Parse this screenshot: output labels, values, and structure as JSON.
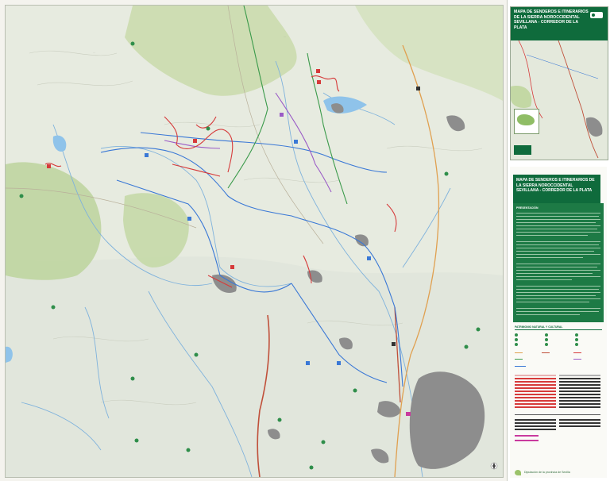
{
  "document": {
    "title": "MAPA DE SENDEROS E ITINERARIOS DE LA SIERRA NOROCCIDENTAL SEVILLANA - CORREDOR DE LA PLATA"
  },
  "info_panel": {
    "section_presentacion": "PRESENTACIÓN",
    "section_legend": "PATRIMONIO NATURAL Y CULTURAL"
  },
  "footer": {
    "publisher": "Diputación de la provincia de Sevilla"
  },
  "colors": {
    "background_relief": "#e6eadf",
    "natural_park": "#b8d19a",
    "urban_area": "#8d8d8d",
    "river": "#7fb2dc",
    "water_body": "#8fc3ea",
    "route_red": "#d63a3a",
    "route_blue": "#3a78d6",
    "route_green": "#3a9a4a",
    "route_purple": "#9a5bc6",
    "road_orange": "#e0a050",
    "road_rail": "#c0503a",
    "brand_green": "#0f6b3c"
  },
  "map_icons": [
    "trail-marker-icon",
    "viewpoint-icon",
    "compass-rose-icon"
  ]
}
